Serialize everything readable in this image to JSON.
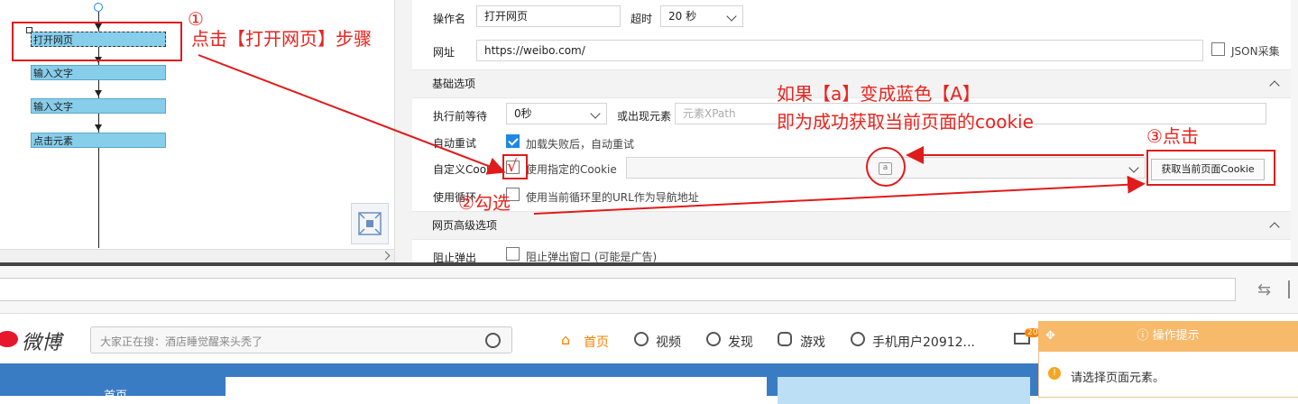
{
  "flow": {
    "steps": [
      "打开网页",
      "输入文字",
      "输入文字",
      "点击元素"
    ]
  },
  "settings": {
    "op_name_label": "操作名",
    "op_name_value": "打开网页",
    "timeout_label": "超时",
    "timeout_value": "20 秒",
    "url_label": "网址",
    "url_value": "https://weibo.com/",
    "json_collect_label": "JSON采集",
    "basic_section": "基础选项",
    "wait_before_label": "执行前等待",
    "wait_before_value": "0秒",
    "or_appear_label": "或出现元素",
    "xpath_placeholder": "元素XPath",
    "auto_retry_label": "自动重试",
    "auto_retry_text": "加载失败后，自动重试",
    "custom_cookie_label": "自定义Cookie",
    "custom_cookie_text": "使用指定的Cookie",
    "cookie_icon_letter": "a",
    "get_cookie_button": "获取当前页面Cookie",
    "loop_label": "使用循环",
    "loop_text": "使用当前循环里的URL作为导航地址",
    "advanced_section": "网页高级选项",
    "block_popup_label": "阻止弹出",
    "block_popup_text": "阻止弹出窗口 (可能是广告)"
  },
  "browser": {
    "weibo_logo": "微博",
    "search_placeholder": "大家正在搜：酒店睡觉醒来头秃了",
    "nav_home": "首页",
    "nav_video": "视频",
    "nav_discover": "发现",
    "nav_game": "游戏",
    "nav_user": "手机用户20912...",
    "mail_badge": "20",
    "body_home": "首页",
    "hint_title": "操作提示",
    "hint_text": "请选择页面元素。"
  },
  "annotations": {
    "step1": "①",
    "step1_text": "点击【打开网页】步骤",
    "step2": "②勾选",
    "check_mark": "√",
    "step3": "③点击",
    "result_line1": "如果【a】变成蓝色【A】",
    "result_line2": "即为成功获取当前页面的cookie"
  },
  "colors": {
    "annotation_red": "#e8231e",
    "step_fill": "#87ceeb",
    "weibo_orange": "#ff8200",
    "hint_orange": "#f7b96a",
    "checkbox_blue": "#1e88e5"
  }
}
